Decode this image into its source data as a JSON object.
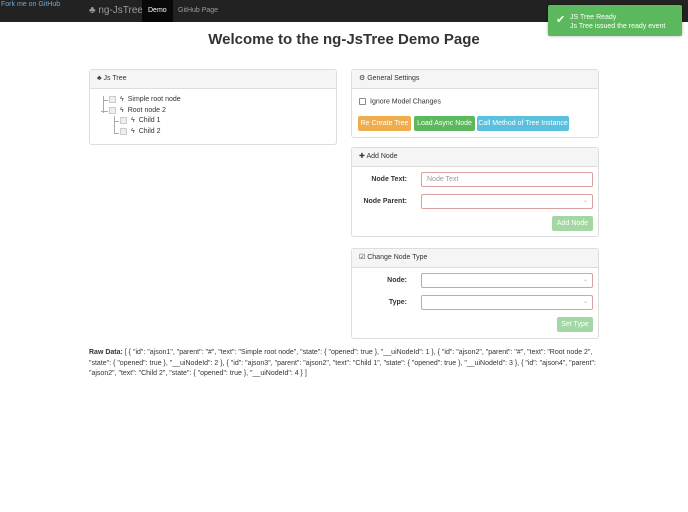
{
  "fork_link": "Fork me on GitHub",
  "nav": {
    "brand": "ng-JsTree",
    "tabs": [
      {
        "label": "Demo",
        "active": true
      },
      {
        "label": "GitHub Page",
        "active": false
      }
    ]
  },
  "toast": {
    "title": "JS Tree Ready",
    "message": "Js Tree issued the ready event",
    "color": "#5cb85c"
  },
  "title": "Welcome to the ng-JsTree Demo Page",
  "tree_panel": {
    "title": "Js Tree",
    "nodes": [
      "Simple root node",
      "Root node 2",
      "Child 1",
      "Child 2"
    ]
  },
  "general": {
    "title": "General Settings",
    "checkbox": "Ignore Model Changes",
    "buttons": [
      "Re Create Tree",
      "Load Async Node",
      "Call Method of Tree Instance"
    ]
  },
  "add_node": {
    "title": "Add Node",
    "text_label": "Node Text:",
    "text_placeholder": "Node Text",
    "parent_label": "Node Parent:",
    "button": "Add Node"
  },
  "change_type": {
    "title": "Change Node Type",
    "node_label": "Node:",
    "type_label": "Type:",
    "button": "Set Type"
  },
  "raw": {
    "label": "Raw Data:",
    "value": "[ { \"id\": \"ajson1\", \"parent\": \"#\", \"text\": \"Simple root node\", \"state\": { \"opened\": true }, \"__uiNodeId\": 1 }, { \"id\": \"ajson2\", \"parent\": \"#\", \"text\": \"Root node 2\", \"state\": { \"opened\": true }, \"__uiNodeId\": 2 }, { \"id\": \"ajson3\", \"parent\": \"ajson2\", \"text\": \"Child 1\", \"state\": { \"opened\": true }, \"__uiNodeId\": 3 }, { \"id\": \"ajson4\", \"parent\": \"ajson2\", \"text\": \"Child 2\", \"state\": { \"opened\": true }, \"__uiNodeId\": 4 } ]"
  }
}
